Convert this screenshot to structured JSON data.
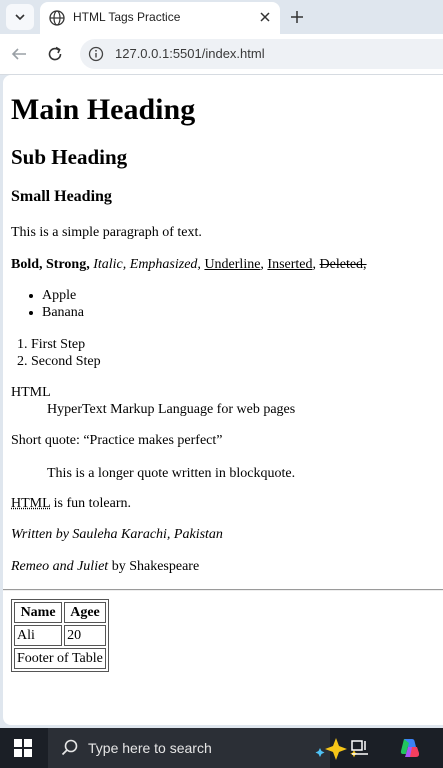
{
  "browser": {
    "tab_title": "HTML Tags Practice",
    "url": "127.0.0.1:5501/index.html"
  },
  "page": {
    "h1": "Main Heading",
    "h2": "Sub Heading",
    "h3": "Small Heading",
    "paragraph": "This is a simple paragraph of text.",
    "formatting": {
      "bold": "Bold,",
      "strong": "Strong,",
      "italic": "Italic,",
      "emphasized": "Emphasized,",
      "underline": "Underline",
      "sep1": ",",
      "inserted": "Inserted",
      "sep2": ",",
      "deleted": "Deleted,"
    },
    "unordered_list": [
      "Apple",
      "Banana"
    ],
    "ordered_list": [
      "First Step",
      "Second Step"
    ],
    "definition": {
      "term": "HTML",
      "description": "HyperText Markup Language for web pages"
    },
    "short_quote": {
      "label": "Short quote:",
      "quote": "“Practice makes perfect”"
    },
    "blockquote": "This is a longer quote written in blockquote.",
    "abbr_line": {
      "abbr": "HTML",
      "rest": "is fun tolearn."
    },
    "address": "Written by Sauleha Karachi, Pakistan",
    "cite_line": {
      "cite": "Remeo and Juliet",
      "rest": "by Shakespeare"
    },
    "table": {
      "headers": [
        "Name",
        "Agee"
      ],
      "row": [
        "Ali",
        "20"
      ],
      "footer": "Footer of Table"
    }
  },
  "taskbar": {
    "search_placeholder": "Type here to search"
  }
}
